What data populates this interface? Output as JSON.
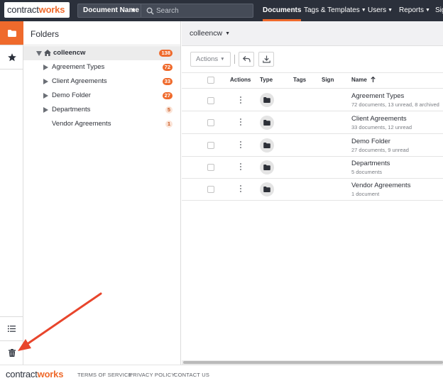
{
  "brand": {
    "part1": "contract",
    "part2": "works",
    "accent": "#ef6a2c",
    "nav_bg": "#2b303b"
  },
  "search": {
    "scope_label": "Document Name",
    "placeholder": "Search"
  },
  "nav": {
    "items": [
      {
        "label": "Documents",
        "active": true,
        "dropdown": false
      },
      {
        "label": "Tags & Templates",
        "dropdown": true
      },
      {
        "label": "Users",
        "dropdown": true
      },
      {
        "label": "Reports",
        "dropdown": true
      },
      {
        "label": "Sig",
        "dropdown": false
      }
    ]
  },
  "rail": {
    "top": [
      {
        "icon": "folder-icon",
        "active": true
      },
      {
        "icon": "star-icon"
      }
    ],
    "bottom": [
      {
        "icon": "list-icon"
      },
      {
        "icon": "trash-icon"
      }
    ]
  },
  "folders": {
    "title": "Folders",
    "root": {
      "label": "colleencw",
      "count": "138",
      "icon": "home-icon"
    },
    "children": [
      {
        "label": "Agreement Types",
        "count": "72",
        "expandable": true
      },
      {
        "label": "Client Agreements",
        "count": "33",
        "expandable": true
      },
      {
        "label": "Demo Folder",
        "count": "27",
        "expandable": true
      },
      {
        "label": "Departments",
        "count": "5",
        "expandable": true
      },
      {
        "label": "Vendor Agreements",
        "count": "1",
        "expandable": false
      }
    ]
  },
  "main": {
    "breadcrumb": "colleencw",
    "toolbar": {
      "actions_label": "Actions",
      "undo_icon": "undo-icon",
      "download_icon": "download-icon"
    },
    "columns": {
      "actions": "Actions",
      "type": "Type",
      "tags": "Tags",
      "sign": "Sign",
      "name": "Name"
    },
    "sort": {
      "column": "Name",
      "direction": "ascending"
    },
    "rows": [
      {
        "name": "Agreement Types",
        "meta": "72 documents, 13 unread, 8 archived"
      },
      {
        "name": "Client Agreements",
        "meta": "33 documents, 12 unread"
      },
      {
        "name": "Demo Folder",
        "meta": "27 documents, 9 unread"
      },
      {
        "name": "Departments",
        "meta": "5 documents"
      },
      {
        "name": "Vendor Agreements",
        "meta": "1 document"
      }
    ]
  },
  "footer": {
    "terms": "TERMS OF SERVICE",
    "privacy": "PRIVACY POLICY",
    "contact": "CONTACT US"
  },
  "annotation": {
    "type": "arrow",
    "color": "#e8452c",
    "points_to": "trash-icon"
  }
}
